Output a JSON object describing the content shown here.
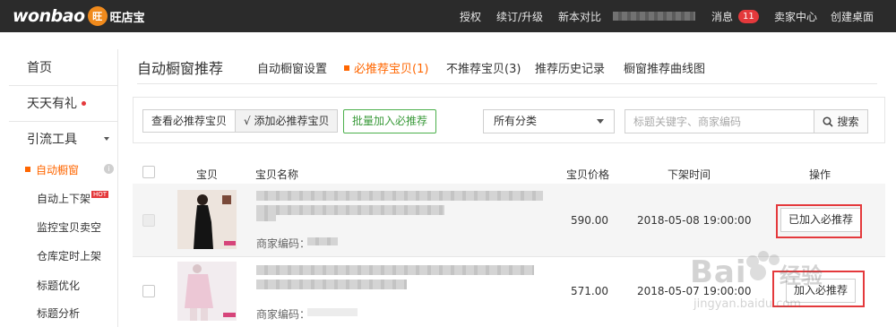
{
  "app": {
    "logo_text": "wonbao",
    "logo_badge": "旺",
    "logo_cn": "旺店宝"
  },
  "topnav": {
    "items": [
      "授权",
      "续订/升级",
      "新本对比"
    ],
    "messages_label": "消息",
    "messages_count": "11",
    "seller_center": "卖家中心",
    "create_desktop": "创建桌面"
  },
  "sidebar": {
    "home": "首页",
    "daily_gift": "天天有礼",
    "traffic_tools": "引流工具",
    "auto_window": "自动橱窗",
    "auto_shelf": "自动上下架",
    "hot_tag": "HOT",
    "monitor_empty": "监控宝贝卖空",
    "warehouse_timer": "仓库定时上架",
    "title_opt": "标题优化",
    "title_analysis": "标题分析"
  },
  "header": {
    "title": "自动橱窗推荐",
    "tabs": [
      {
        "label": "自动橱窗设置",
        "active": false
      },
      {
        "label": "必推荐宝贝(1)",
        "active": true
      },
      {
        "label": "不推荐宝贝(3)",
        "active": false
      },
      {
        "label": "推荐历史记录",
        "active": false
      },
      {
        "label": "橱窗推荐曲线图",
        "active": false
      }
    ]
  },
  "toolbar": {
    "view_required": "查看必推荐宝贝",
    "add_required": "√ 添加必推荐宝贝",
    "batch_add": "批量加入必推荐",
    "category": "所有分类",
    "search_placeholder": "标题关键字、商家编码",
    "search_button": "搜索"
  },
  "table": {
    "headers": {
      "item": "宝贝",
      "name": "宝贝名称",
      "price": "宝贝价格",
      "off_time": "下架时间",
      "action": "操作"
    },
    "rows": [
      {
        "code_label": "商家编码：",
        "price": "590.00",
        "off_time": "2018-05-08 19:00:00",
        "action": "已加入必推荐",
        "added": true
      },
      {
        "code_label": "商家编码：",
        "price": "571.00",
        "off_time": "2018-05-07 19:00:00",
        "action": "加入必推荐",
        "added": false
      }
    ]
  },
  "colors": {
    "accent": "#ff6600",
    "green": "#4cb04c",
    "highlight_red": "#e4393c",
    "topbar": "#2b2b2b"
  },
  "watermark": {
    "brand": "Bai",
    "brand_cn": "经验",
    "url": "jingyan.baidu.com"
  }
}
